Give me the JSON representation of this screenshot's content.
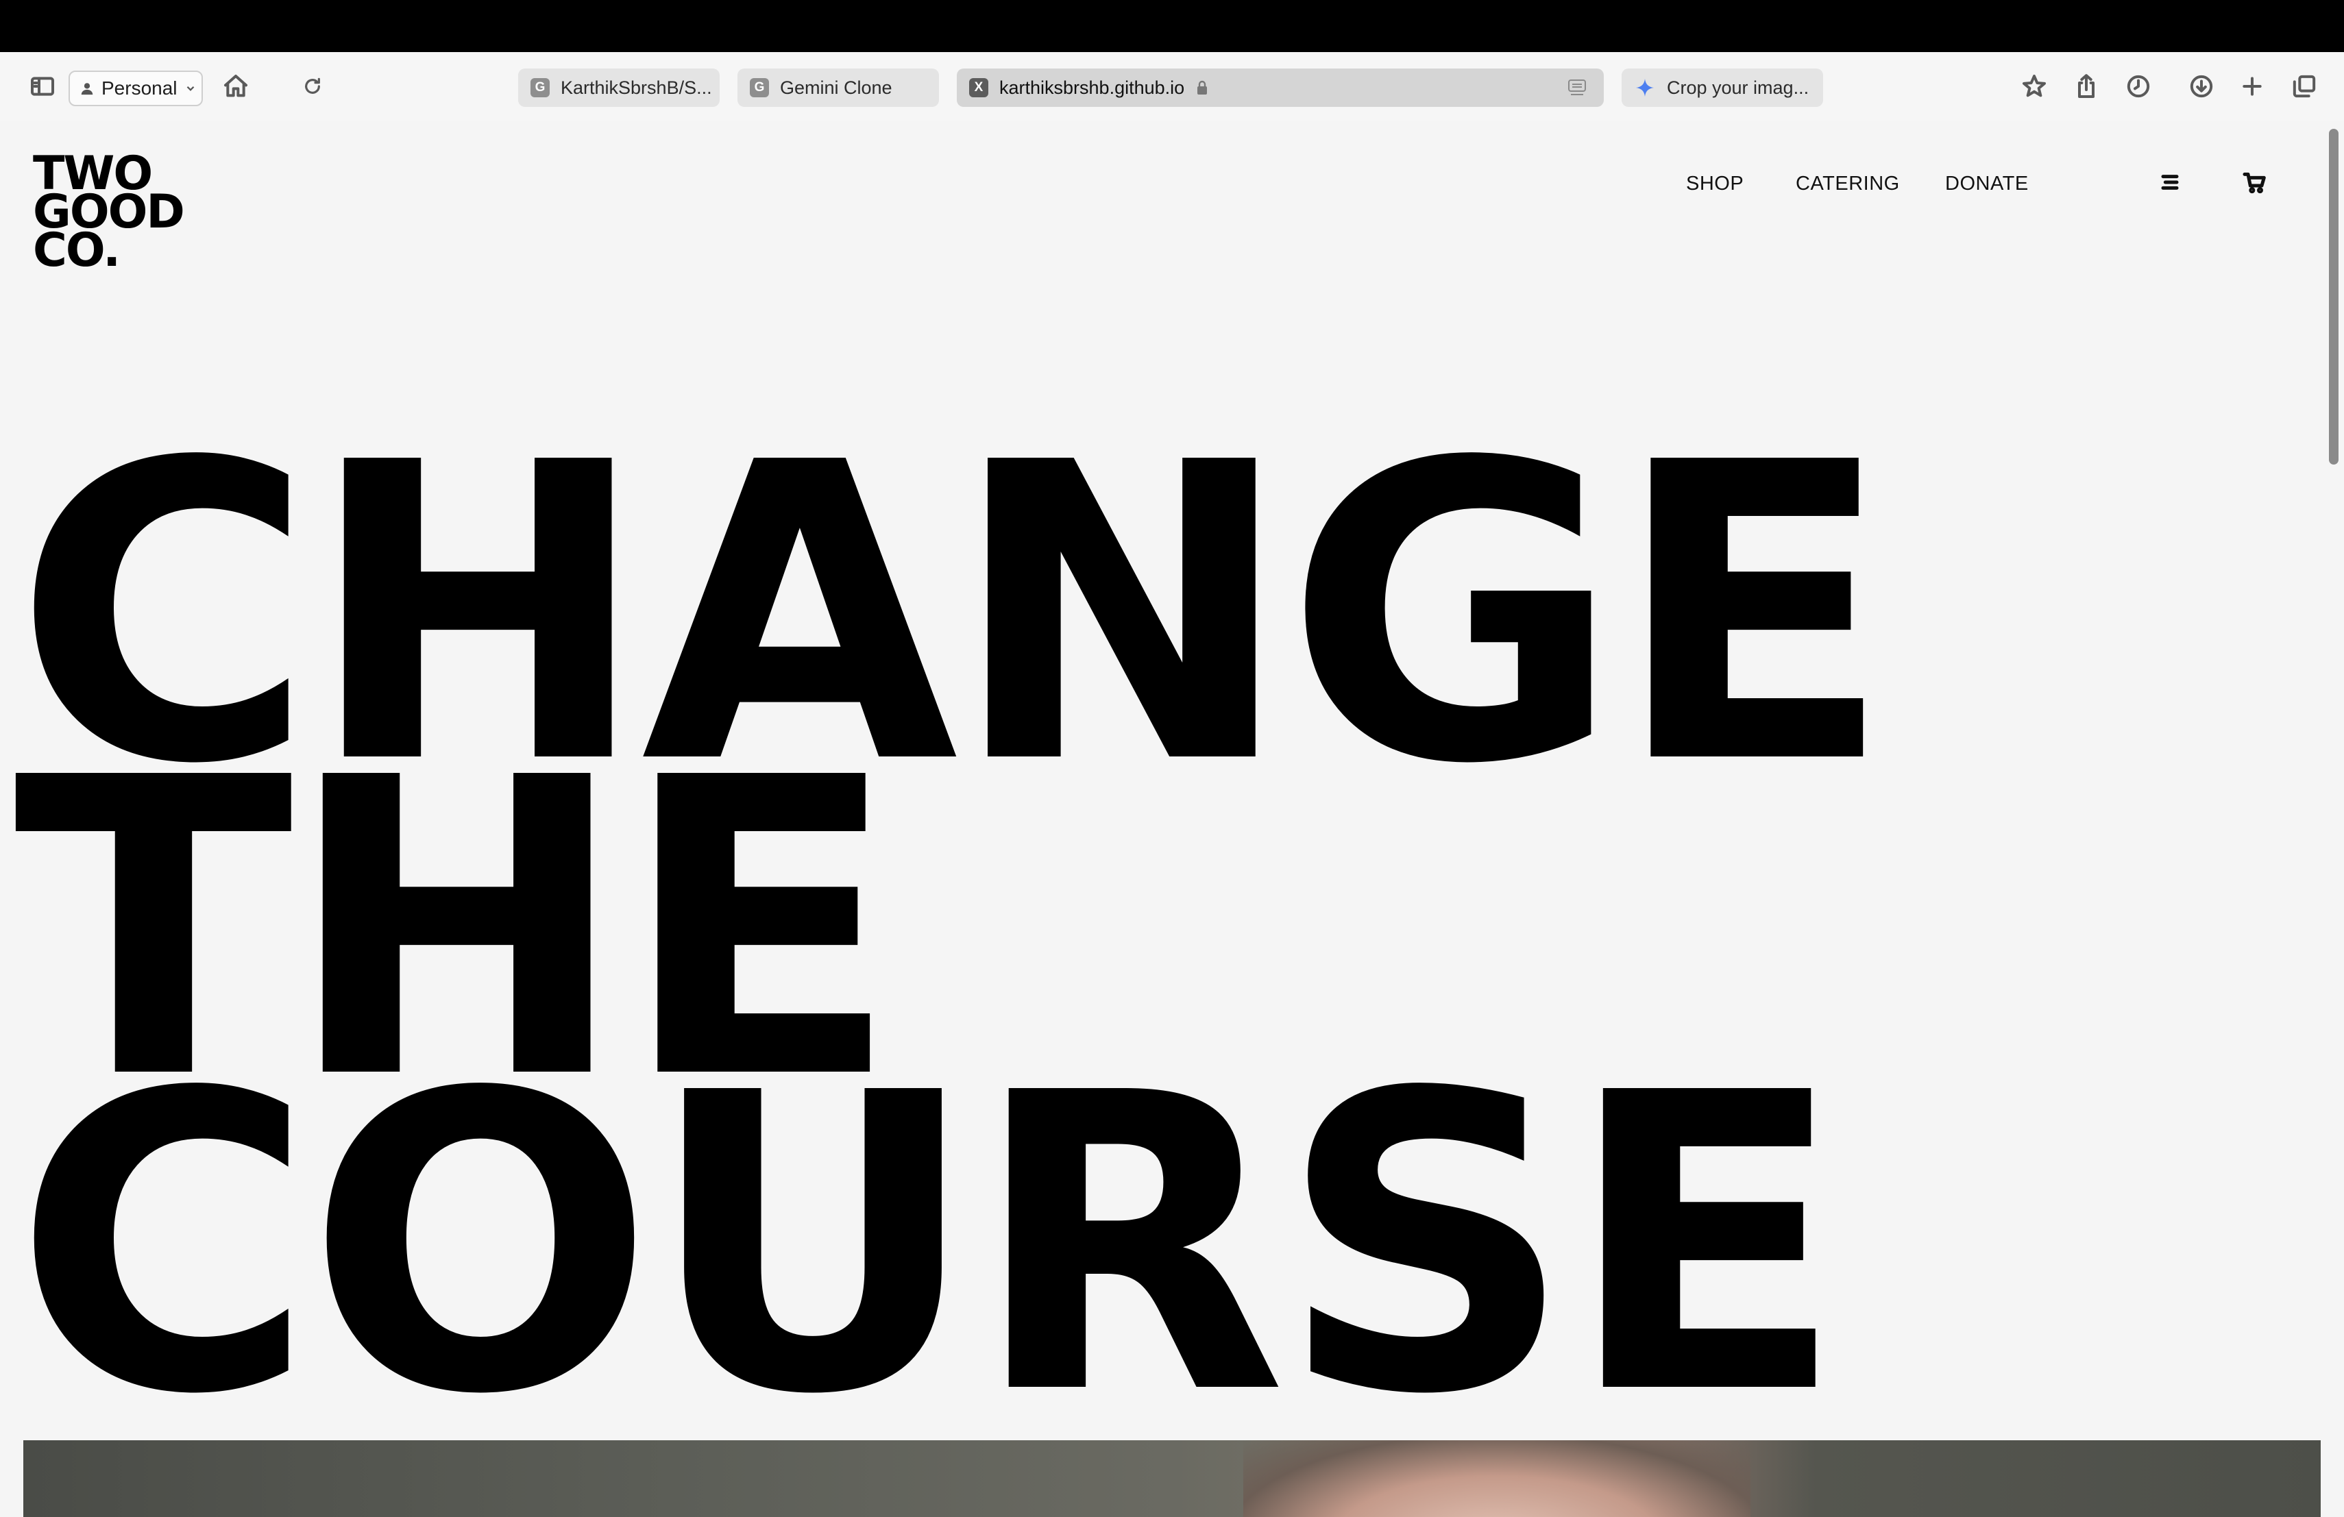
{
  "browser": {
    "profile_label": "Personal",
    "tabs": [
      {
        "favicon": "G",
        "title": "KarthikSbrshB/S..."
      },
      {
        "favicon": "G",
        "title": "Gemini Clone"
      },
      {
        "favicon": "X",
        "title": "karthiksbrshb.github.io",
        "active": true
      },
      {
        "favicon": "gemini-icon",
        "title": "Crop your imag..."
      }
    ],
    "toolbar_icons": [
      "sidebar-icon",
      "home-icon",
      "reload-icon",
      "star-icon",
      "share-icon",
      "history-icon",
      "download-icon",
      "new-tab-icon",
      "tab-overview-icon"
    ]
  },
  "site": {
    "logo": {
      "line1": "TWO",
      "line2": "GOOD",
      "line3": "CO."
    },
    "nav": {
      "shop": "SHOP",
      "catering": "CATERING",
      "donate": "DONATE"
    },
    "nav_icons": [
      "menu-icon",
      "cart-icon"
    ],
    "hero": {
      "line1": "CHANGE",
      "line2": "THE",
      "line3": "COURSE"
    }
  }
}
